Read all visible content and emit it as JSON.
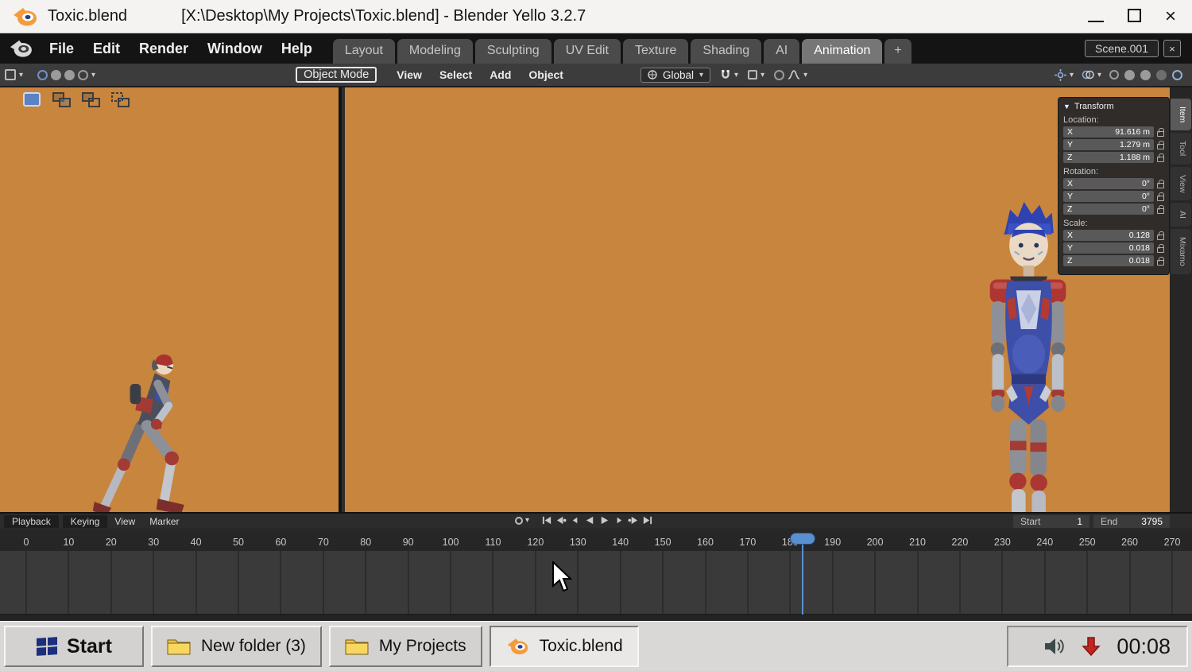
{
  "titlebar": {
    "app_title": "Toxic.blend",
    "document_title": "[X:\\Desktop\\My Projects\\Toxic.blend] - Blender Yello 3.2.7"
  },
  "window_controls": {
    "minimize": "—",
    "maximize": "□",
    "close": "×"
  },
  "menubar": {
    "menus": [
      "File",
      "Edit",
      "Render",
      "Window",
      "Help"
    ],
    "workspaces": [
      {
        "label": "Layout"
      },
      {
        "label": "Modeling"
      },
      {
        "label": "Sculpting"
      },
      {
        "label": "UV Edit"
      },
      {
        "label": "Texture"
      },
      {
        "label": "Shading"
      },
      {
        "label": "AI"
      },
      {
        "label": "Animation",
        "active": true
      }
    ],
    "add_workspace": "+",
    "scene_name": "Scene.001",
    "scene_close": "×"
  },
  "toolbar": {
    "mode": "Object Mode",
    "menus": [
      "View",
      "Select",
      "Add",
      "Object"
    ],
    "orientation_label": "Global"
  },
  "transform": {
    "title": "Transform",
    "groups": [
      {
        "label": "Location:",
        "rows": [
          {
            "axis": "X",
            "value": "91.616 m"
          },
          {
            "axis": "Y",
            "value": "1.279 m"
          },
          {
            "axis": "Z",
            "value": "1.188 m"
          }
        ]
      },
      {
        "label": "Rotation:",
        "rows": [
          {
            "axis": "X",
            "value": "0°"
          },
          {
            "axis": "Y",
            "value": "0°"
          },
          {
            "axis": "Z",
            "value": "0°"
          }
        ]
      },
      {
        "label": "Scale:",
        "rows": [
          {
            "axis": "X",
            "value": "0.128"
          },
          {
            "axis": "Y",
            "value": "0.018"
          },
          {
            "axis": "Z",
            "value": "0.018"
          }
        ]
      }
    ],
    "tabs": [
      {
        "label": "Item",
        "active": true
      },
      {
        "label": "Tool"
      },
      {
        "label": "View"
      },
      {
        "label": "AI"
      },
      {
        "label": "Mixamo"
      }
    ]
  },
  "timeline": {
    "menus": [
      "Playback",
      "Keying",
      "View",
      "Marker"
    ],
    "controls": [
      "jump-to-start",
      "previous-keyframe",
      "previous-frame",
      "play-reverse",
      "play",
      "next-frame",
      "next-keyframe",
      "jump-to-end"
    ],
    "ticks": [
      0,
      10,
      20,
      30,
      40,
      50,
      60,
      70,
      80,
      90,
      100,
      110,
      120,
      130,
      140,
      150,
      160,
      170,
      180,
      190,
      200,
      210,
      220,
      230,
      240,
      250,
      260,
      270
    ],
    "playhead_frame": 183,
    "start_label": "Start",
    "start_value": "1",
    "end_label": "End",
    "end_value": "3795"
  },
  "taskbar": {
    "start_label": "Start",
    "buttons": [
      {
        "label": "New folder (3)",
        "icon": "folder"
      },
      {
        "label": "My Projects",
        "icon": "folder"
      },
      {
        "label": "Toxic.blend",
        "icon": "blender",
        "active": true
      }
    ],
    "clock": "00:08"
  },
  "icons": {
    "chevron_down": "▾",
    "panel_collapse": "▼"
  },
  "colors": {
    "viewport_background": "#c8853e",
    "playhead_blue": "#5a8fd0",
    "taskbar_gray": "#d9d8d6",
    "tray_alert_red": "#c42420"
  }
}
